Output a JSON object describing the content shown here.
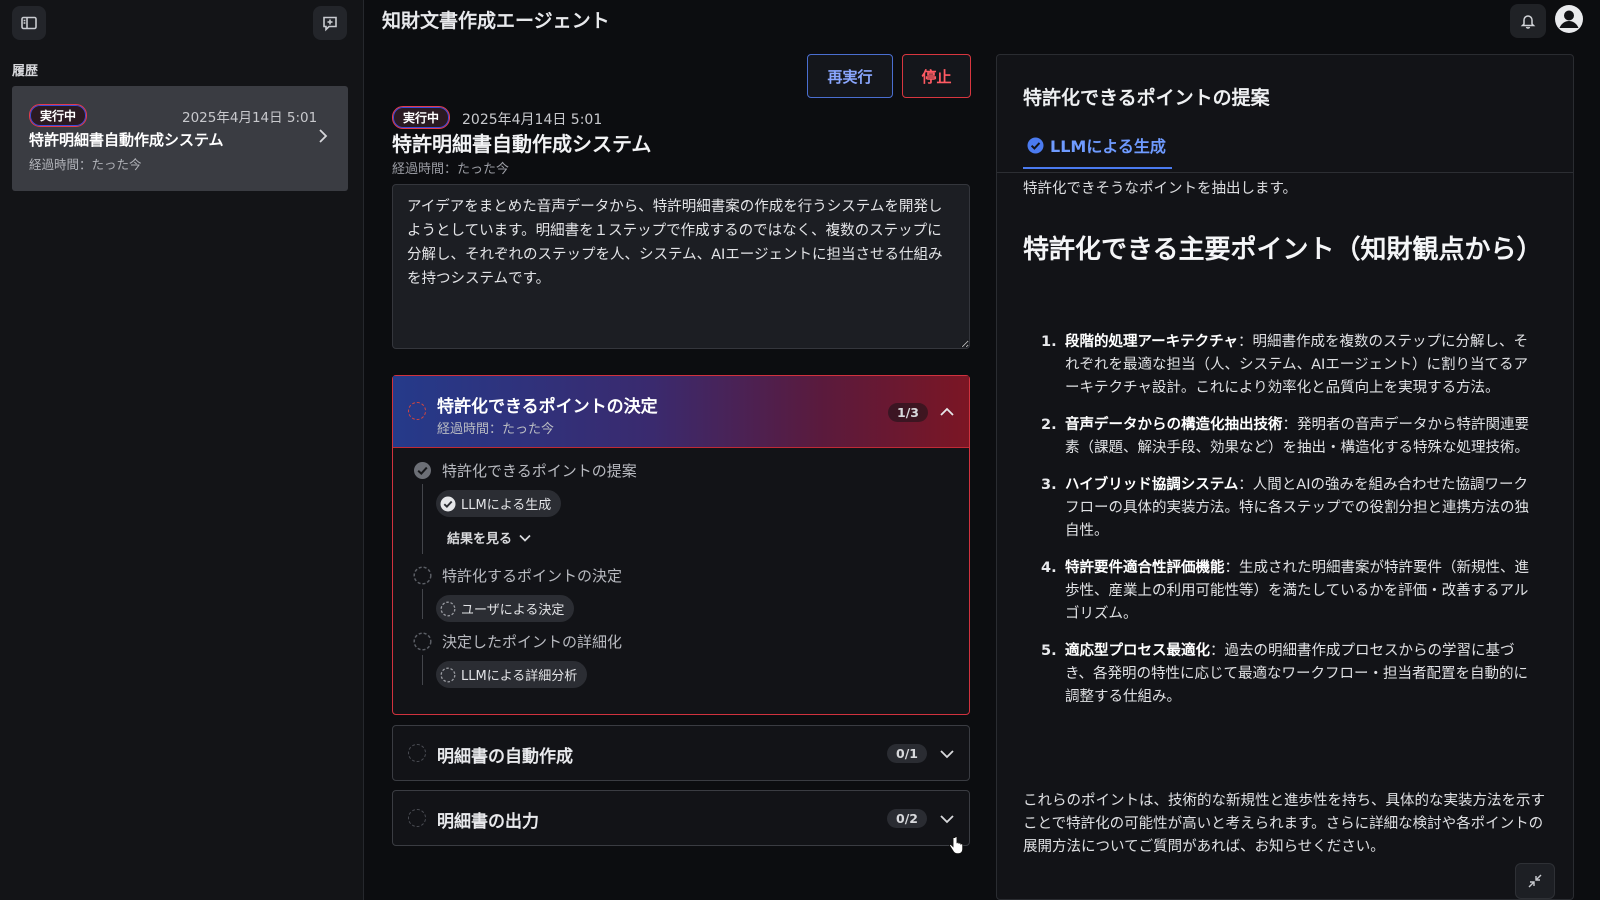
{
  "app": {
    "title": "知財文書作成エージェント"
  },
  "sidebar": {
    "history_label": "履歴",
    "history": [
      {
        "status": "実行中",
        "date": "2025年4月14日 5:01",
        "title": "特許明細書自動作成システム",
        "elapsed": "経過時間：たった今"
      }
    ]
  },
  "actions": {
    "rerun": "再実行",
    "stop": "停止"
  },
  "task": {
    "status": "実行中",
    "date": "2025年4月14日 5:01",
    "title": "特許明細書自動作成システム",
    "elapsed": "経過時間：たった今",
    "description": "アイデアをまとめた音声データから、特許明細書案の作成を行うシステムを開発しようとしています。明細書を１ステップで作成するのではなく、複数のステップに分解し、それぞれのステップを人、システム、AIエージェントに担当させる仕組みを持つシステムです。"
  },
  "steps": [
    {
      "title": "特許化できるポイントの決定",
      "elapsed": "経過時間：たった今",
      "count": "1/3",
      "substeps": [
        {
          "label": "特許化できるポイントの提案",
          "chip": "LLMによる生成",
          "done": true,
          "see_results": "結果を見る"
        },
        {
          "label": "特許化するポイントの決定",
          "chip": "ユーザによる決定",
          "done": false
        },
        {
          "label": "決定したポイントの詳細化",
          "chip": "LLMによる詳細分析",
          "done": false
        }
      ]
    },
    {
      "title": "明細書の自動作成",
      "count": "0/1"
    },
    {
      "title": "明細書の出力",
      "count": "0/2"
    }
  ],
  "result": {
    "title": "特許化できるポイントの提案",
    "tab": "LLMによる生成",
    "intro": "特許化できそうなポイントを抽出します。",
    "heading": "特許化できる主要ポイント（知財観点から）",
    "points": [
      {
        "num": "1.",
        "term": "段階的処理アーキテクチャ",
        "desc": "：明細書作成を複数のステップに分解し、それぞれを最適な担当（人、システム、AIエージェント）に割り当てるアーキテクチャ設計。これにより効率化と品質向上を実現する方法。"
      },
      {
        "num": "2.",
        "term": "音声データからの構造化抽出技術",
        "desc": "：発明者の音声データから特許関連要素（課題、解決手段、効果など）を抽出・構造化する特殊な処理技術。"
      },
      {
        "num": "3.",
        "term": "ハイブリッド協調システム",
        "desc": "：人間とAIの強みを組み合わせた協調ワークフローの具体的実装方法。特に各ステップでの役割分担と連携方法の独自性。"
      },
      {
        "num": "4.",
        "term": "特許要件適合性評価機能",
        "desc": "：生成された明細書案が特許要件（新規性、進歩性、産業上の利用可能性等）を満たしているかを評価・改善するアルゴリズム。"
      },
      {
        "num": "5.",
        "term": "適応型プロセス最適化",
        "desc": "：過去の明細書作成プロセスからの学習に基づき、各発明の特性に応じて最適なワークフロー・担当者配置を自動的に調整する仕組み。"
      }
    ],
    "conclusion": "これらのポイントは、技術的な新規性と進歩性を持ち、具体的な実装方法を示すことで特許化の可能性が高いと考えられます。さらに詳細な検討や各ポイントの展開方法についてご質問があれば、お知らせください。"
  },
  "icons": {
    "sidebar_toggle": "sidebar-toggle-icon",
    "new_chat": "new-chat-icon",
    "bell": "bell-icon",
    "user": "user-icon",
    "check": "check-circle-icon",
    "pending": "dashed-circle-icon"
  },
  "colors": {
    "accent_blue": "#4b7bf0",
    "accent_red": "#d8363f"
  }
}
